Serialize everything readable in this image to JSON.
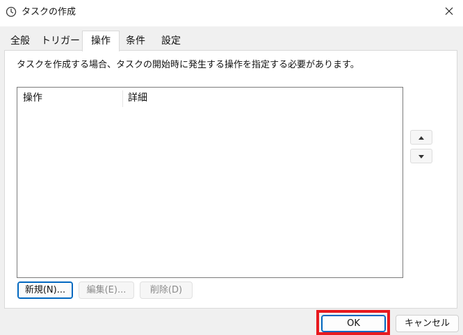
{
  "window": {
    "title": "タスクの作成",
    "icon": "clock-icon",
    "close_icon": "close-icon"
  },
  "tabs": [
    {
      "label": "全般",
      "active": false
    },
    {
      "label": "トリガー",
      "active": false
    },
    {
      "label": "操作",
      "active": true
    },
    {
      "label": "条件",
      "active": false
    },
    {
      "label": "設定",
      "active": false
    }
  ],
  "panel": {
    "instruction": "タスクを作成する場合、タスクの開始時に発生する操作を指定する必要があります。",
    "list": {
      "columns": [
        "操作",
        "詳細"
      ],
      "rows": []
    },
    "move_up_icon": "triangle-up-icon",
    "move_down_icon": "triangle-down-icon",
    "buttons": {
      "new": "新規(N)...",
      "edit": "編集(E)...",
      "delete": "削除(D)"
    }
  },
  "footer": {
    "ok": "OK",
    "cancel": "キャンセル"
  },
  "colors": {
    "accent": "#0067c0",
    "highlight": "#e8191e"
  }
}
